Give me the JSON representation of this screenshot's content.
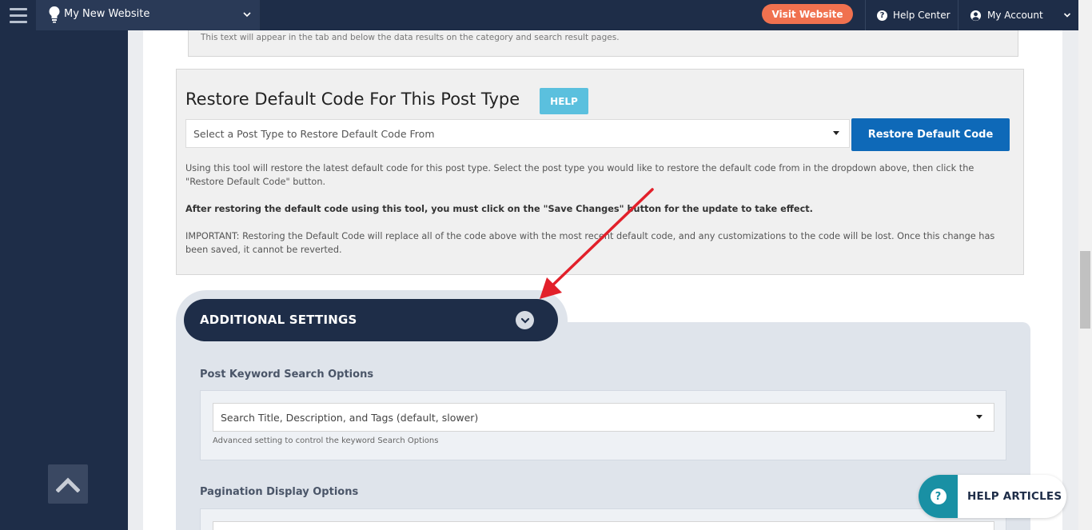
{
  "topbar": {
    "site_name": "My New Website",
    "visit_label": "Visit Website",
    "help_center_label": "Help Center",
    "account_label": "My Account"
  },
  "previous_panel": {
    "note": "This text will appear in the tab and below the data results on the category and search result pages."
  },
  "restore": {
    "title": "Restore Default Code For This Post Type",
    "help_label": "HELP",
    "select_placeholder": "Select a Post Type to Restore Default Code From",
    "button_label": "Restore Default Code",
    "desc1": "Using this tool will restore the latest default code for this post type. Select the post type you would like to restore the default code from in the dropdown above, then click the \"Restore Default Code\" button.",
    "desc2": "After restoring the default code using this tool, you must click on the \"Save Changes\" button for the update to take effect.",
    "desc3": "IMPORTANT: Restoring the Default Code will replace all of the code above with the most recent default code, and any customizations to the code will be lost. Once this change has been saved, it cannot be reverted."
  },
  "additional_settings": {
    "title": "ADDITIONAL SETTINGS",
    "keyword": {
      "label": "Post Keyword Search Options",
      "selected": "Search Title, Description, and Tags (default, slower)",
      "hint": "Advanced setting to control the keyword Search Options"
    },
    "pagination": {
      "label": "Pagination Display Options"
    }
  },
  "help_widget": {
    "label": "HELP ARTICLES"
  },
  "colors": {
    "navy": "#1e2d48",
    "visit_orange": "#f0714f",
    "restore_blue": "#0e69b8",
    "help_cyan": "#5bc0de",
    "annotation_red": "#e2202a",
    "help_widget_teal": "#1990a4"
  },
  "icons": {
    "menu": "hamburger-icon",
    "site": "lightbulb-icon",
    "help": "question-circle-icon",
    "account": "user-circle-icon",
    "scroll_top": "chevron-up-icon",
    "toggle": "chevron-down-icon"
  }
}
